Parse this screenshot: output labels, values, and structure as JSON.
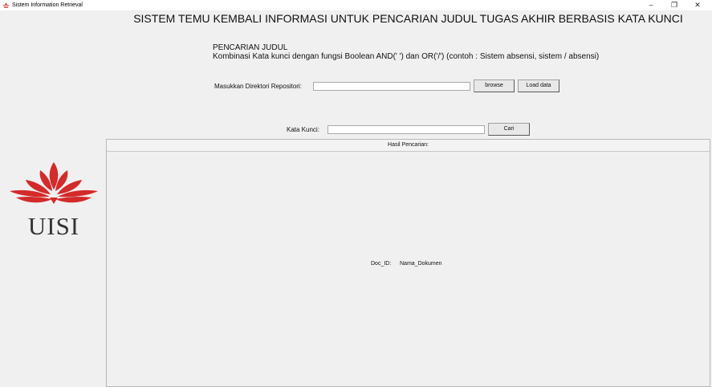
{
  "window": {
    "title": "Sistem Information Retrieval",
    "minimize": "–",
    "restore": "❐",
    "close": "✕"
  },
  "header": {
    "title": "SISTEM TEMU KEMBALI INFORMASI UNTUK PENCARIAN JUDUL TUGAS AKHIR BERBASIS KATA KUNCI",
    "subtitle": "PENCARIAN JUDUL",
    "description": "Kombinasi Kata kunci dengan fungsi Boolean AND(' ') dan OR('/') (contoh : Sistem absensi, sistem / absensi)"
  },
  "repository": {
    "label": "Masukkan Direktori Repositori:",
    "value": "",
    "browse_label": "browse",
    "load_label": "Load data"
  },
  "search": {
    "label": "Kata Kunci:",
    "value": "",
    "button_label": "Cari"
  },
  "results": {
    "header": "Hasil Pencarian:",
    "columns": [
      "Doc_ID:",
      "Nama_Dokumen"
    ]
  },
  "logo": {
    "text": "UISI",
    "color": "#d42a2a"
  }
}
